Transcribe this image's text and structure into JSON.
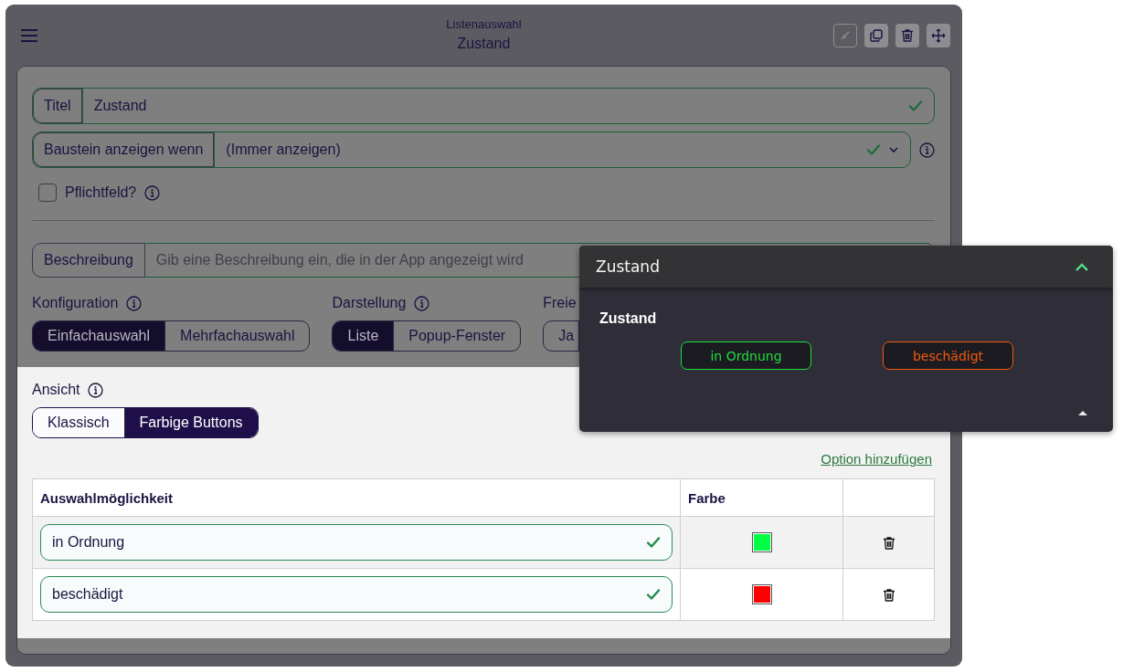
{
  "window": {
    "subtitle": "Listenauswahl",
    "title": "Zustand"
  },
  "toolbar_buttons": [
    {
      "kind": "collapse",
      "disabled": true
    },
    {
      "kind": "duplicate",
      "disabled": false
    },
    {
      "kind": "delete",
      "disabled": false
    },
    {
      "kind": "move",
      "disabled": false
    }
  ],
  "title_field": {
    "label": "Titel",
    "value": "Zustand",
    "valid": true
  },
  "condition_field": {
    "label": "Baustein anzeigen wenn",
    "value": "(Immer anzeigen)",
    "valid": true
  },
  "required": {
    "label": "Pflichtfeld?",
    "checked": false
  },
  "description_field": {
    "label": "Beschreibung",
    "placeholder": "Gib eine Beschreibung ein, die in der App angezeigt wird"
  },
  "option_groups": [
    {
      "label": "Konfiguration",
      "options": [
        {
          "label": "Einfachauswahl",
          "selected": true
        },
        {
          "label": "Mehrfachauswahl",
          "selected": false
        }
      ]
    },
    {
      "label": "Darstellung",
      "options": [
        {
          "label": "Liste",
          "selected": true
        },
        {
          "label": "Popup-Fenster",
          "selected": false
        }
      ]
    },
    {
      "label": "Freie",
      "options": [
        {
          "label": "Ja",
          "selected": false
        }
      ]
    }
  ],
  "view": {
    "label": "Ansicht",
    "options": [
      {
        "label": "Klassisch",
        "selected": false
      },
      {
        "label": "Farbige Buttons",
        "selected": true
      }
    ]
  },
  "add_option_link": "Option hinzufügen",
  "table": {
    "columns": [
      "Auswahlmöglichkeit",
      "Farbe"
    ],
    "rows": [
      {
        "value": "in Ordnung",
        "valid": true,
        "color": "#00ff44"
      },
      {
        "value": "beschädigt",
        "valid": true,
        "color": "#ff0000"
      }
    ]
  },
  "preview": {
    "title": "Zustand",
    "heading": "Zustand",
    "buttons": [
      {
        "label": "in Ordnung",
        "color": "#1fdd3f"
      },
      {
        "label": "beschädigt",
        "color": "#f05a0a"
      }
    ]
  }
}
